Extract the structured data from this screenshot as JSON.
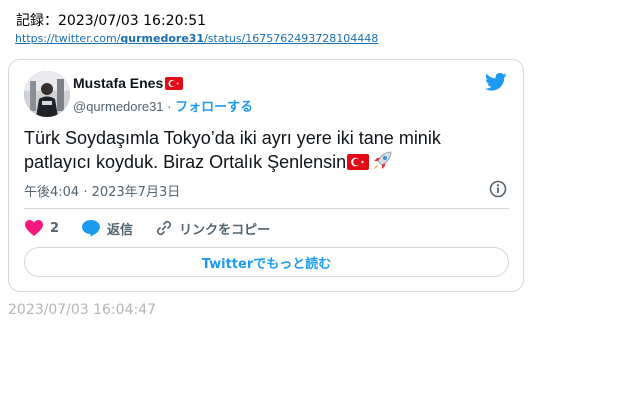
{
  "record": {
    "label": "記録：2023/07/03 16:20:51"
  },
  "link": {
    "prefix": "https://twitter.com/",
    "user": "qurmedore31",
    "suffix": "/status/1675762493728104448"
  },
  "tweet": {
    "author_name": "Mustafa Enes",
    "author_handle": "@qurmedore31",
    "separator": "·",
    "follow_label": "フォローする",
    "text": "Türk Soydaşımla Tokyo’da iki ayrı yere iki tane minik patlayıcı koyduk. Biraz Ortalık Şenlensin",
    "timestamp": "午後4:04 · 2023年7月3日",
    "like_count": "2",
    "reply_label": "返信",
    "copy_link_label": "リンクをコピー",
    "read_more_label": "Twitterでもっと読む"
  },
  "footer": {
    "archive_time": "2023/07/03 16:04:47"
  },
  "colors": {
    "accent": "#1d9bf0",
    "like": "#f91880",
    "muted": "#536471",
    "border": "#cfd9de",
    "flag_red": "#e30a17"
  },
  "icons": [
    "twitter-bird-icon",
    "info-icon",
    "heart-icon",
    "reply-bubble-icon",
    "link-icon",
    "turkey-flag-icon",
    "rocket-icon"
  ]
}
